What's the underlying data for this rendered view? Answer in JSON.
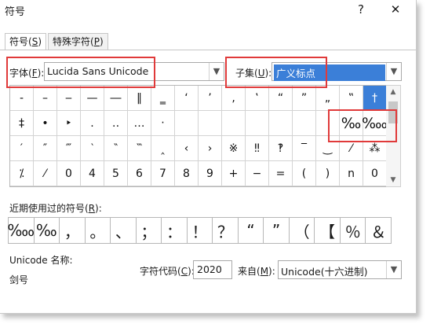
{
  "window": {
    "title": "符号",
    "help_glyph": "?",
    "close_glyph": "✕"
  },
  "tabs": [
    {
      "label": "符号(",
      "key": "S",
      "tail": ")"
    },
    {
      "label": "特殊字符(",
      "key": "P",
      "tail": ")"
    }
  ],
  "font": {
    "label": "字体(",
    "key": "F",
    "tail": "):",
    "value": "Lucida Sans Unicode"
  },
  "subset": {
    "label": "子集(",
    "key": "U",
    "tail": "):",
    "value": "广义标点"
  },
  "symbols": [
    [
      "‐",
      "–",
      "‒",
      "—",
      "―",
      "‖",
      "‗",
      "‘",
      "’",
      "‚",
      "‛",
      "“",
      "”",
      "„",
      "‟",
      "†"
    ],
    [
      "‡",
      "•",
      "‣",
      "․",
      "‥",
      "…",
      "‧",
      "",
      "",
      "",
      "",
      "",
      "",
      "",
      "‰",
      "‱"
    ],
    [
      "′",
      "″",
      "‴",
      "‵",
      "‶",
      "‷",
      "‸",
      "‹",
      "›",
      "※",
      "‼",
      "‽",
      "‾",
      "‿",
      "⁄",
      "⁂"
    ],
    [
      "⁒",
      "⁄",
      "0",
      "4",
      "5",
      "6",
      "7",
      "8",
      "9",
      "+",
      "−",
      "=",
      "(",
      ")",
      "n",
      "0"
    ]
  ],
  "recent": {
    "label": "近期使用过的符号(",
    "key": "R",
    "tail": "):",
    "items": [
      "‱",
      "‰",
      "，",
      "。",
      "、",
      "；",
      "：",
      "！",
      "？",
      "“",
      "”",
      "（",
      "【",
      "％",
      "＆"
    ]
  },
  "unicode_name_label": "Unicode 名称:",
  "unicode_name_value": "剑号",
  "char_code": {
    "label": "字符代码(",
    "key": "C",
    "tail": "):",
    "value": "2020"
  },
  "from": {
    "label": "来自(",
    "key": "M",
    "tail": "):",
    "value": "Unicode(十六进制)"
  },
  "colors": {
    "highlight": "#3b7fd8",
    "annotation_red": "#e03a3a"
  }
}
